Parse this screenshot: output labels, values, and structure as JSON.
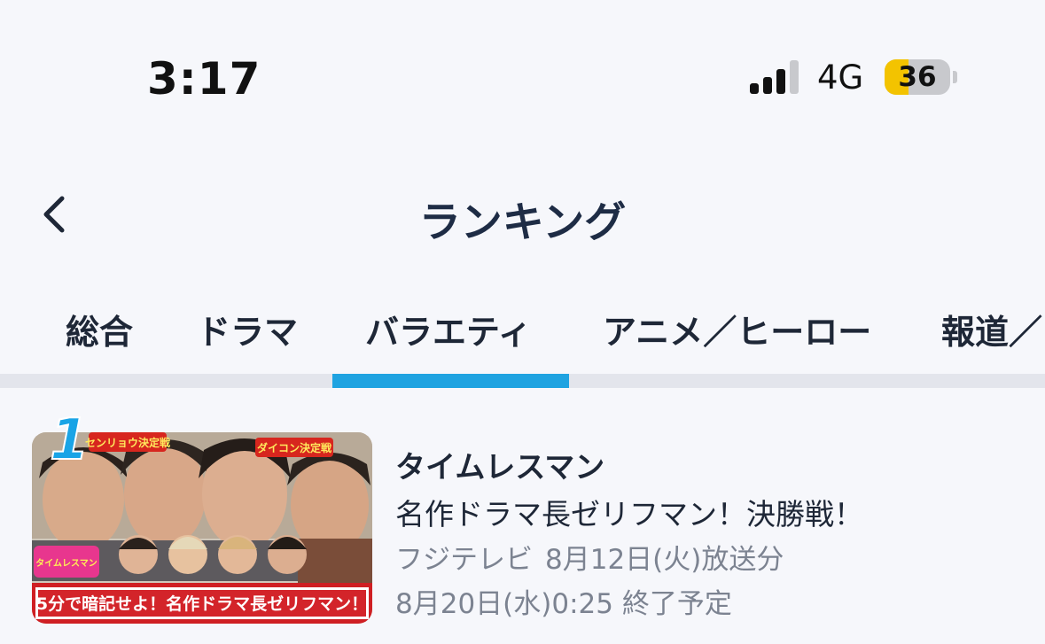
{
  "status_bar": {
    "time": "3:17",
    "network": "4G",
    "battery_percent": 36,
    "battery_level": 0.36,
    "signal_bars_active": 3,
    "signal_bars_total": 4
  },
  "header": {
    "title": "ランキング",
    "back_icon": "chevron-left-icon"
  },
  "tabs": [
    {
      "label": "総合",
      "selected": false
    },
    {
      "label": "ドラマ",
      "selected": false
    },
    {
      "label": "バラエティ",
      "selected": true
    },
    {
      "label": "アニメ／ヒーロー",
      "selected": false
    },
    {
      "label": "報道／",
      "selected": false
    }
  ],
  "ranking": [
    {
      "rank": "1",
      "show_title": "タイムレスマン",
      "episode_title": "名作ドラマ長ゼリフマン！決勝戦！",
      "network": "フジテレビ",
      "broadcast": "8月12日(火)放送分",
      "expiry": "8月20日(水)0:25 終了予定",
      "thumbnail": {
        "label_left": "センリョウ決定戦",
        "label_right": "ダイコン決定戦",
        "logo": "タイムレスマン",
        "banner": "5分で暗記せよ！名作ドラマ長ゼリフマン！"
      }
    }
  ],
  "colors": {
    "background": "#f6f7fb",
    "accent": "#1fa3e1",
    "text_primary": "#1e2737",
    "text_secondary": "#7c8391",
    "battery_fill": "#f3c300"
  }
}
